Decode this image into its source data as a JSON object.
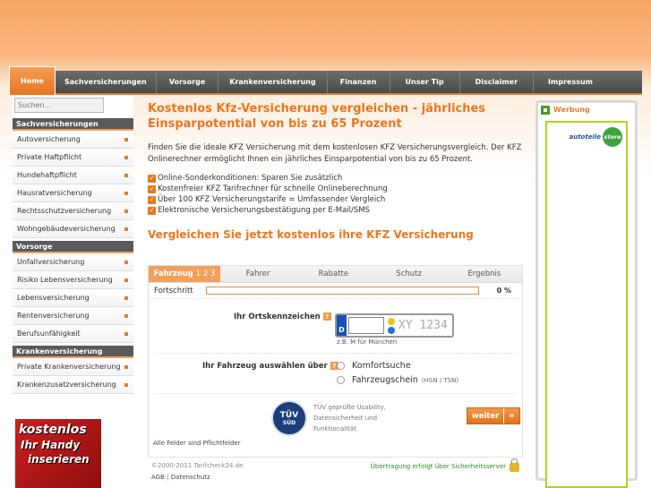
{
  "nav": {
    "items": [
      {
        "label": "Home",
        "active": true
      },
      {
        "label": "Sachversicherungen"
      },
      {
        "label": "Vorsorge"
      },
      {
        "label": "Krankenversicherung"
      },
      {
        "label": "Finanzen"
      },
      {
        "label": "Unser Tip"
      },
      {
        "label": "Disclaimer"
      },
      {
        "label": "Impressum"
      }
    ]
  },
  "sidebar": {
    "search_placeholder": "Suchen...",
    "groups": [
      {
        "title": "Sachversicherungen",
        "items": [
          "Autoversicherung",
          "Private Haftpflicht",
          "Hundehaftpflicht",
          "Hausratversicherung",
          "Rechtsschutzversicherung",
          "Wohngebäudeversicherung"
        ]
      },
      {
        "title": "Vorsorge",
        "items": [
          "Unfallversicherung",
          "Risiko Lebensversicherung",
          "Lebensversicherung",
          "Rentenversicherung",
          "Berufsunfähigkeit"
        ]
      },
      {
        "title": "Krankenversicherung",
        "items": [
          "Private Krankenversicherung",
          "Krankenzusatzversicherung"
        ]
      }
    ],
    "ad_lines": [
      "kostenlos",
      "Ihr Handy",
      "inserieren"
    ]
  },
  "main": {
    "title": "Kostenlos Kfz-Versicherung vergleichen - jährliches Einsparpotential von bis zu 65 Prozent",
    "intro": "Finden Sie die ideale KFZ Versicherung mit dem kostenlosen KFZ Versicherungsvergleich. Der KFZ Onlinerechner ermöglicht Ihnen ein jährliches Einsparpotential von bis zu 65 Prozent.",
    "features": [
      "Online-Sonderkonditionen: Sparen Sie zusätzlich",
      "Kostenfreier KFZ Tarifrechner für schnelle Onlineberechnung",
      "Über 100 KFZ Versicherungstarife = Umfassender Vergleich",
      "Elektronische Versicherungsbestätigung per E-Mail/SMS"
    ],
    "compare_title": "Vergleichen Sie jetzt kostenlos ihre KFZ Versicherung"
  },
  "form": {
    "steps": [
      {
        "label": "Fahrzeug",
        "nums": "1 2 3",
        "active": true
      },
      {
        "label": "Fahrer"
      },
      {
        "label": "Rabatte"
      },
      {
        "label": "Schutz"
      },
      {
        "label": "Ergebnis"
      }
    ],
    "progress_label": "Fortschritt",
    "progress_value": 0,
    "progress_text": "0 %",
    "ort_label": "Ihr Ortskennzeichen",
    "plate_country": "D",
    "plate_placeholder": "XY 1234",
    "plate_hint": "z.B. M für München",
    "vehicle_label": "Ihr Fahrzeug auswählen über",
    "option_comfort": "Komfortsuche",
    "option_registration": "Fahrzeugschein",
    "option_registration_sub": "(HSN / TSN)",
    "tuv_seal_text": "TÜV",
    "tuv_seal_sub": "SÜD",
    "tuv_text": "TÜV geprüfte Usability, Datensicherheit und Funktionalität",
    "next_button": "weiter",
    "required_note": "Alle Felder sind Pflichtfelder"
  },
  "footer": {
    "copyright": "©2000-2011 Tarifcheck24.de",
    "agb": "AGB",
    "privacy": "Datenschutz",
    "secure": "Übertragung erfolgt über Sicherheitsserver"
  },
  "right": {
    "ad_label": "Werbung",
    "logo_text": "autoteile",
    "logo_store": "store"
  }
}
